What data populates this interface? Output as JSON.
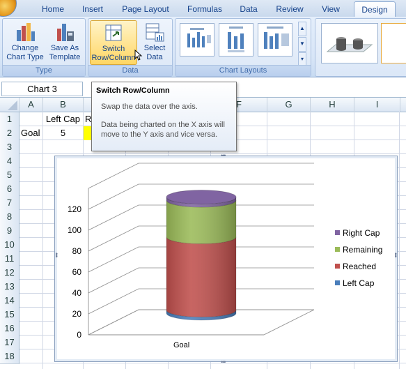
{
  "ribbon": {
    "tabs": [
      "Home",
      "Insert",
      "Page Layout",
      "Formulas",
      "Data",
      "Review",
      "View",
      "Design"
    ],
    "active_tab": "Design",
    "groups": {
      "type": {
        "label": "Type",
        "change_chart_type": [
          "Change",
          "Chart Type"
        ],
        "save_as_template": [
          "Save As",
          "Template"
        ]
      },
      "data": {
        "label": "Data",
        "switch_row_column": [
          "Switch",
          "Row/Column"
        ],
        "select_data": [
          "Select",
          "Data"
        ]
      },
      "chart_layouts": {
        "label": "Chart Layouts"
      }
    }
  },
  "formula_bar": {
    "name_box": "Chart 3"
  },
  "tooltip": {
    "title": "Switch Row/Column",
    "line1": "Swap the data over the axis.",
    "line2": "Data being charted on the X axis will move to the Y axis and vice versa."
  },
  "sheet": {
    "columns": [
      "A",
      "B",
      "C",
      "D",
      "E",
      "F",
      "G",
      "H",
      "I"
    ],
    "rows": [
      "1",
      "2",
      "3",
      "4",
      "5",
      "6",
      "7",
      "8",
      "9",
      "10",
      "11",
      "12",
      "13",
      "14",
      "15",
      "16",
      "17",
      "18"
    ],
    "cells": {
      "B1": "Left Cap",
      "C1": "R",
      "A2": "Goal",
      "B2": "5"
    }
  },
  "colors": {
    "left_cap": "#4a7ebb",
    "reached": "#c0504d",
    "remaining": "#9bbb59",
    "right_cap": "#8064a2",
    "highlight_cell": "#ffff00"
  },
  "chart_data": {
    "type": "bar",
    "subtype": "3-D stacked cylinder",
    "categories": [
      "Goal"
    ],
    "series": [
      {
        "name": "Left Cap",
        "values": [
          3
        ]
      },
      {
        "name": "Reached",
        "values": [
          70
        ]
      },
      {
        "name": "Remaining",
        "values": [
          35
        ]
      },
      {
        "name": "Right Cap",
        "values": [
          3
        ]
      }
    ],
    "y_ticks": [
      "0",
      "20",
      "40",
      "60",
      "80",
      "100",
      "120"
    ],
    "ylim": [
      0,
      140
    ],
    "grid": true,
    "legend_position": "right"
  }
}
